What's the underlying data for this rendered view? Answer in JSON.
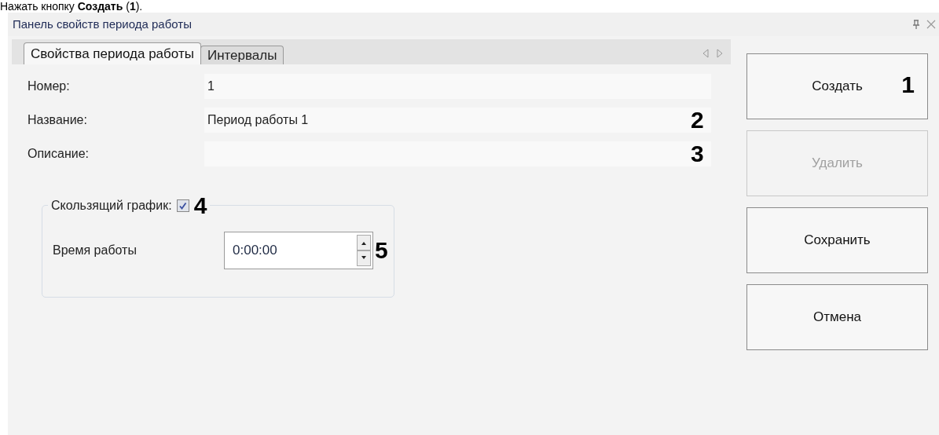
{
  "caption": "Нажать кнопку **Создать** (**1**).",
  "panel": {
    "title": "Панель свойств периода работы"
  },
  "tabs": [
    {
      "label": "Свойства периода работы",
      "selected": true
    },
    {
      "label": "Интервалы",
      "selected": false
    }
  ],
  "fields": [
    {
      "label": "Номер:",
      "value": "1"
    },
    {
      "label": "Название:",
      "value": "Период работы 1",
      "marker": "2"
    },
    {
      "label": "Описание:",
      "marker": "3"
    }
  ],
  "sliding_schedule": {
    "label": "Скользящий график:",
    "checked": true,
    "marker": "4"
  },
  "work_time": {
    "label": "Время работы",
    "value": "0:00:00",
    "marker": "5"
  },
  "buttons": [
    {
      "label": "Создать",
      "disabled": false,
      "marker": "1"
    },
    {
      "label": "Удалить",
      "disabled": true
    },
    {
      "label": "Сохранить",
      "disabled": false
    },
    {
      "label": "Отмена",
      "disabled": false
    }
  ]
}
